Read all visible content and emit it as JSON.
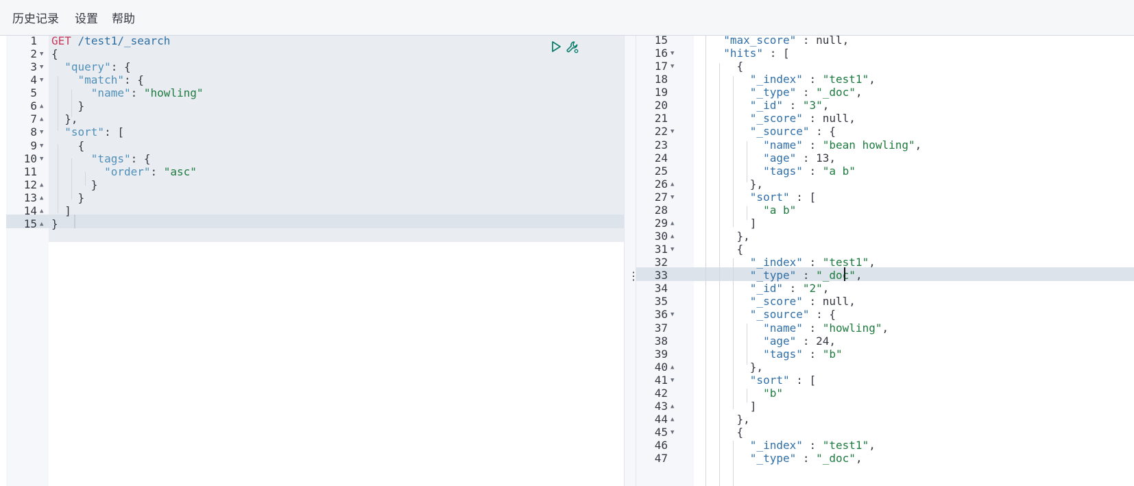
{
  "menubar": {
    "history": "历史记录",
    "settings": "设置",
    "help": "帮助"
  },
  "icons": {
    "run": "play-icon",
    "wrench": "wrench-icon",
    "divider": "vertical-ellipsis-icon"
  },
  "colors": {
    "method": "#c73a5a",
    "key": "#4f8fb8",
    "string": "#1d7a3e",
    "url": "#2e6fa3",
    "selected_line": "#dde3eb"
  },
  "request": {
    "lines": [
      {
        "n": "1",
        "fold": "",
        "html": "<span class='m'>GET</span> <span class='u'>/test1/_search</span>"
      },
      {
        "n": "2",
        "fold": "▼",
        "html": "{"
      },
      {
        "n": "3",
        "fold": "▼",
        "html": "  <span class='k'>\"query\"</span>: {"
      },
      {
        "n": "4",
        "fold": "▼",
        "html": "    <span class='k'>\"match\"</span>: {"
      },
      {
        "n": "5",
        "fold": "",
        "html": "      <span class='k'>\"name\"</span>: <span class='s'>\"howling\"</span>"
      },
      {
        "n": "6",
        "fold": "▲",
        "html": "    }"
      },
      {
        "n": "7",
        "fold": "▲",
        "html": "  },"
      },
      {
        "n": "8",
        "fold": "▼",
        "html": "  <span class='k'>\"sort\"</span>: ["
      },
      {
        "n": "9",
        "fold": "▼",
        "html": "    {"
      },
      {
        "n": "10",
        "fold": "▼",
        "html": "      <span class='k'>\"tags\"</span>: {"
      },
      {
        "n": "11",
        "fold": "",
        "html": "        <span class='k'>\"order\"</span>: <span class='s'>\"asc\"</span>"
      },
      {
        "n": "12",
        "fold": "▲",
        "html": "      }"
      },
      {
        "n": "13",
        "fold": "▲",
        "html": "    }"
      },
      {
        "n": "14",
        "fold": "▲",
        "html": "  ]"
      },
      {
        "n": "15",
        "fold": "▲",
        "html": "}"
      }
    ]
  },
  "response": {
    "lines": [
      {
        "n": "15",
        "fold": "",
        "html": "  <span class='k2'>\"max_score\"</span> : null,"
      },
      {
        "n": "16",
        "fold": "▼",
        "html": "  <span class='k2'>\"hits\"</span> : ["
      },
      {
        "n": "17",
        "fold": "▼",
        "html": "    {"
      },
      {
        "n": "18",
        "fold": "",
        "html": "      <span class='k2'>\"_index\"</span> : <span class='s'>\"test1\"</span>,"
      },
      {
        "n": "19",
        "fold": "",
        "html": "      <span class='k2'>\"_type\"</span> : <span class='s'>\"_doc\"</span>,"
      },
      {
        "n": "20",
        "fold": "",
        "html": "      <span class='k2'>\"_id\"</span> : <span class='s'>\"3\"</span>,"
      },
      {
        "n": "21",
        "fold": "",
        "html": "      <span class='k2'>\"_score\"</span> : null,"
      },
      {
        "n": "22",
        "fold": "▼",
        "html": "      <span class='k2'>\"_source\"</span> : {"
      },
      {
        "n": "23",
        "fold": "",
        "html": "        <span class='k2'>\"name\"</span> : <span class='s'>\"bean howling\"</span>,"
      },
      {
        "n": "24",
        "fold": "",
        "html": "        <span class='k2'>\"age\"</span> : 13,"
      },
      {
        "n": "25",
        "fold": "",
        "html": "        <span class='k2'>\"tags\"</span> : <span class='s'>\"a b\"</span>"
      },
      {
        "n": "26",
        "fold": "▲",
        "html": "      },"
      },
      {
        "n": "27",
        "fold": "▼",
        "html": "      <span class='k2'>\"sort\"</span> : ["
      },
      {
        "n": "28",
        "fold": "",
        "html": "        <span class='s'>\"a b\"</span>"
      },
      {
        "n": "29",
        "fold": "▲",
        "html": "      ]"
      },
      {
        "n": "30",
        "fold": "▲",
        "html": "    },"
      },
      {
        "n": "31",
        "fold": "▼",
        "html": "    {"
      },
      {
        "n": "32",
        "fold": "",
        "html": "      <span class='k2'>\"_index\"</span> : <span class='s'>\"test1\"</span>,"
      },
      {
        "n": "33",
        "fold": "",
        "html": "      <span class='k2'>\"_type\"</span> : <span class='s'>\"_doc\"</span>,"
      },
      {
        "n": "34",
        "fold": "",
        "html": "      <span class='k2'>\"_id\"</span> : <span class='s'>\"2\"</span>,"
      },
      {
        "n": "35",
        "fold": "",
        "html": "      <span class='k2'>\"_score\"</span> : null,"
      },
      {
        "n": "36",
        "fold": "▼",
        "html": "      <span class='k2'>\"_source\"</span> : {"
      },
      {
        "n": "37",
        "fold": "",
        "html": "        <span class='k2'>\"name\"</span> : <span class='s'>\"howling\"</span>,"
      },
      {
        "n": "38",
        "fold": "",
        "html": "        <span class='k2'>\"age\"</span> : 24,"
      },
      {
        "n": "39",
        "fold": "",
        "html": "        <span class='k2'>\"tags\"</span> : <span class='s'>\"b\"</span>"
      },
      {
        "n": "40",
        "fold": "▲",
        "html": "      },"
      },
      {
        "n": "41",
        "fold": "▼",
        "html": "      <span class='k2'>\"sort\"</span> : ["
      },
      {
        "n": "42",
        "fold": "",
        "html": "        <span class='s'>\"b\"</span>"
      },
      {
        "n": "43",
        "fold": "▲",
        "html": "      ]"
      },
      {
        "n": "44",
        "fold": "▲",
        "html": "    },"
      },
      {
        "n": "45",
        "fold": "▼",
        "html": "    {"
      },
      {
        "n": "46",
        "fold": "",
        "html": "      <span class='k2'>\"_index\"</span> : <span class='s'>\"test1\"</span>,"
      },
      {
        "n": "47",
        "fold": "",
        "html": "      <span class='k2'>\"_type\"</span> : <span class='s'>\"_doc\"</span>,"
      }
    ]
  }
}
